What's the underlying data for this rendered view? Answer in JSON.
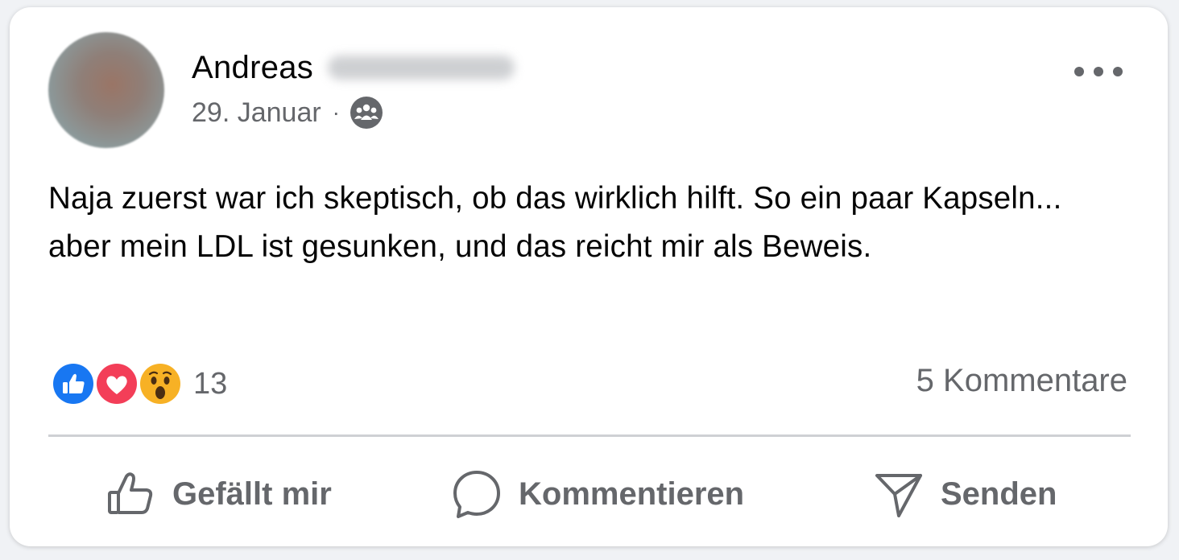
{
  "post": {
    "author_first_name": "Andreas",
    "date": "29. Januar",
    "separator": "·",
    "audience_icon": "group-icon",
    "text": "Naja zuerst war ich skeptisch, ob das wirklich hilft. So ein paar Kapseln... aber mein LDL ist gesunken, und das reicht mir als Beweis."
  },
  "reactions": {
    "icons": [
      "like-reaction-icon",
      "love-reaction-icon",
      "wow-reaction-icon"
    ],
    "count": "13",
    "comments": "5 Kommentare"
  },
  "actions": {
    "like": "Gefällt mir",
    "comment": "Kommentieren",
    "send": "Senden"
  },
  "colors": {
    "like_blue": "#1877f2",
    "love_red": "#f33e58",
    "wow_yellow": "#f7b125",
    "secondary_text": "#65676b"
  }
}
